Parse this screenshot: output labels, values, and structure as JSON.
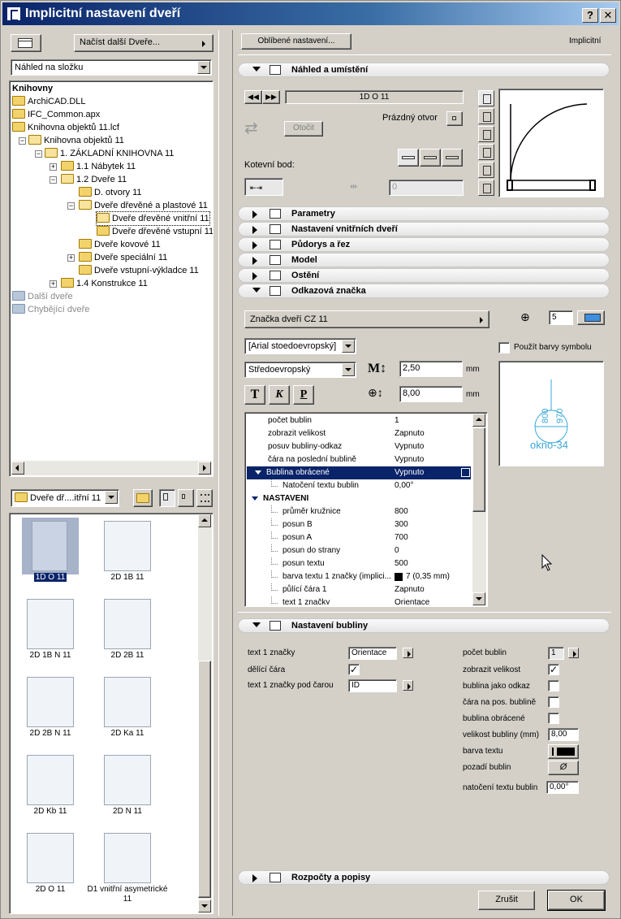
{
  "window": {
    "title": "Implicitní nastavení dveří",
    "help": "?",
    "close": "✕"
  },
  "left": {
    "load_button": "Načíst další Dveře...",
    "view_combo": "Náhled na složku",
    "tree": [
      {
        "label": "Knihovny",
        "bold": true
      },
      {
        "label": "ArchiCAD.DLL"
      },
      {
        "label": "IFC_Common.apx"
      },
      {
        "label": "Knihovna objektů 11.lcf"
      },
      {
        "label": "Knihovna objektů 11",
        "pm": "−"
      },
      {
        "label": "1. ZÁKLADNÍ KNIHOVNA 11",
        "pm": "−"
      },
      {
        "label": "1.1 Nábytek 11",
        "pm": "+"
      },
      {
        "label": "1.2 Dveře 11",
        "pm": "−"
      },
      {
        "label": "D. otvory 11"
      },
      {
        "label": "Dveře dřevěné a plastové 11",
        "pm": "−"
      },
      {
        "label": "Dveře dřevěné vnitřní 11"
      },
      {
        "label": "Dveře dřevěné vstupní 11"
      },
      {
        "label": "Dveře kovové 11"
      },
      {
        "label": "Dveře speciální 11",
        "pm": "+"
      },
      {
        "label": "Dveře vstupní-výkladce 11"
      },
      {
        "label": "1.4 Konstrukce 11",
        "pm": "+"
      },
      {
        "label": "Další dveře",
        "gray": true
      },
      {
        "label": "Chybějící dveře",
        "gray": true
      }
    ],
    "folder_combo": "Dveře dř....itřní 11",
    "thumbnails": [
      {
        "label": "1D O 11",
        "selected": true
      },
      {
        "label": "2D 1B 11"
      },
      {
        "label": "2D 1B N 11"
      },
      {
        "label": "2D 2B 11"
      },
      {
        "label": "2D 2B N 11"
      },
      {
        "label": "2D Ka 11"
      },
      {
        "label": "2D Kb 11"
      },
      {
        "label": "2D N 11"
      },
      {
        "label": "2D O 11"
      },
      {
        "label": "D1 vnitřní asymetrické 11"
      }
    ]
  },
  "right": {
    "favorites_button": "Oblíbené nastavení...",
    "mode_label": "Implicitní",
    "sections": {
      "preview": "Náhled a umístění",
      "params": "Parametry",
      "inner_doors": "Nastavení vnitřních dveří",
      "plan": "Půdorys a řez",
      "model": "Model",
      "lining": "Ostění",
      "marker": "Odkazová značka",
      "bubble": "Nastavení bubliny",
      "budget": "Rozpočty a popisy"
    },
    "preview": {
      "object_name": "1D O 11",
      "empty_opening": "Prázdný otvor",
      "rotate": "Otočit",
      "anchor_label": "Kotevní bod:",
      "offset_value": "0"
    },
    "marker": {
      "marker_name": "Značka dveří CZ 11",
      "pen_value": "5",
      "use_symbol_colors": "Použít barvy symbolu",
      "font_name": "[Arial stoedoevropský]",
      "encoding": "Středoevropský",
      "size_value": "2,50",
      "size_unit": "mm",
      "offset_value": "8,00",
      "offset_unit": "mm",
      "style_buttons": [
        "T",
        "K",
        "P"
      ],
      "preview_text": "okno-34",
      "preview_dims": [
        "800",
        "970"
      ],
      "properties": [
        {
          "k": "počet bublin",
          "v": "1",
          "indent": 1
        },
        {
          "k": "zobrazit velikost",
          "v": "Zapnuto",
          "indent": 1
        },
        {
          "k": "posuv bubliny-odkaz",
          "v": "Vypnuto",
          "indent": 1
        },
        {
          "k": "čára na poslední bublině",
          "v": "Vypnuto",
          "indent": 1
        },
        {
          "k": "Bublina obrácené",
          "v": "Vypnuto",
          "indent": 0,
          "selected": true
        },
        {
          "k": "Natočení textu bublin",
          "v": "0,00°",
          "indent": 2
        },
        {
          "k": "NASTAVENI",
          "v": "",
          "indent": 0,
          "bold": true
        },
        {
          "k": "průměr kružnice",
          "v": "800",
          "indent": 2
        },
        {
          "k": "posun B",
          "v": "300",
          "indent": 2
        },
        {
          "k": "posun A",
          "v": "700",
          "indent": 2
        },
        {
          "k": "posun do strany",
          "v": "0",
          "indent": 2
        },
        {
          "k": "posun textu",
          "v": "500",
          "indent": 2
        },
        {
          "k": "barva textu 1 značky (implici...",
          "v": "7 (0,35 mm)",
          "indent": 2
        },
        {
          "k": "půlící čára 1",
          "v": "Zapnuto",
          "indent": 2
        },
        {
          "k": "text 1 značky",
          "v": "Orientace",
          "indent": 2
        }
      ]
    },
    "bubble": {
      "text1_label": "text 1 značky",
      "text1_value": "Orientace",
      "divider_label": "dělící čára",
      "text1_under_label": "text 1 značky pod čarou",
      "text1_under_value": "ID",
      "count_label": "počet bublin",
      "count_value": "1",
      "show_size_label": "zobrazit velikost",
      "bubble_as_ref_label": "bublina jako odkaz",
      "line_on_pos_label": "čára na pos. bublině",
      "bubble_inverted_label": "bublina obrácené",
      "bubble_size_label": "velikost bubliny (mm)",
      "bubble_size_value": "8,00",
      "text_color_label": "barva textu",
      "bubble_bg_label": "pozadí bublin",
      "bubble_bg_symbol": "Ø",
      "rotation_label": "natočení textu bublin",
      "rotation_value": "0,00°"
    },
    "cancel": "Zrušit",
    "ok": "OK"
  }
}
